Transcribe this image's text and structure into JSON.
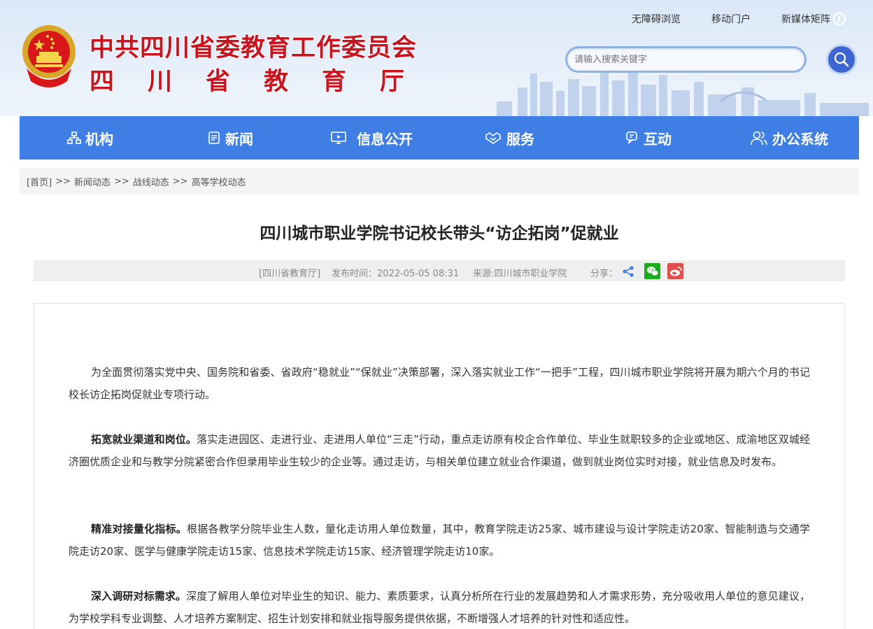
{
  "header": {
    "title": "中共四川省委教育工作委员会",
    "subtitle_chars": [
      "四",
      "川",
      "省",
      "教",
      "育",
      "厅"
    ],
    "links": [
      "无障碍浏览",
      "移动门户",
      "新媒体矩阵"
    ],
    "search_placeholder": "请输入搜索关键字"
  },
  "nav": {
    "items": [
      {
        "label": "机构",
        "icon": "org-chart-icon"
      },
      {
        "label": "新闻",
        "icon": "document-icon"
      },
      {
        "label": "信息公开",
        "icon": "monitor-icon"
      },
      {
        "label": "服务",
        "icon": "handshake-icon"
      },
      {
        "label": "互动",
        "icon": "chat-icon"
      },
      {
        "label": "办公系统",
        "icon": "users-icon"
      }
    ]
  },
  "breadcrumb": {
    "home": "[首页]",
    "separator": ">>",
    "items": [
      "新闻动态",
      "战线动态",
      "高等学校动态"
    ]
  },
  "article": {
    "title": "四川城市职业学院书记校长带头“访企拓岗”促就业",
    "meta": {
      "org": "[四川省教育厅]",
      "published": "发布时间：2022-05-05 08:31",
      "source": "来源:四川城市职业学院",
      "share_label": "分享："
    },
    "paragraphs": [
      {
        "lead": "",
        "text": "为全面贯彻落实党中央、国务院和省委、省政府“稳就业”“保就业”决策部署，深入落实就业工作“一把手”工程，四川城市职业学院将开展为期六个月的书记校长访企拓岗促就业专项行动。"
      },
      {
        "lead": "拓宽就业渠道和岗位。",
        "text": "落实走进园区、走进行业、走进用人单位“三走”行动，重点走访原有校企合作单位、毕业生就职较多的企业或地区、成渝地区双城经济圈优质企业和与教学分院紧密合作但录用毕业生较少的企业等。通过走访，与相关单位建立就业合作渠道，做到就业岗位实时对接，就业信息及时发布。"
      },
      {
        "lead": "精准对接量化指标。",
        "text": "根据各教学分院毕业生人数，量化走访用人单位数量，其中，教育学院走访25家、城市建设与设计学院走访20家、智能制造与交通学院走访20家、医学与健康学院走访15家、信息技术学院走访15家、经济管理学院走访10家。"
      },
      {
        "lead": "深入调研对标需求。",
        "text": "深度了解用人单位对毕业生的知识、能力、素质要求，认真分析所在行业的发展趋势和人才需求形势，充分吸收用人单位的意见建议，为学校学科专业调整、人才培养方案制定、招生计划安排和就业指导服务提供依据，不断增强人才培养的针对性和适应性。"
      }
    ]
  },
  "colors": {
    "nav_bg": "#3f7fe5",
    "title_red": "#c8141e",
    "search_btn": "#3d66d4",
    "wechat": "#1aad19",
    "weibo": "#e0504f"
  }
}
